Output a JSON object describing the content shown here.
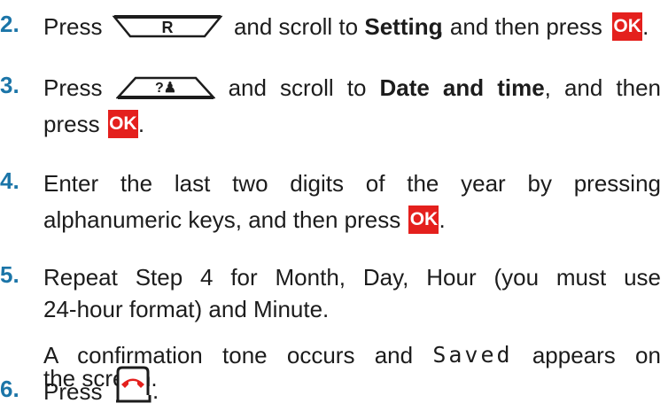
{
  "steps": [
    {
      "number": "2.",
      "lines": [
        {
          "t1": "Press",
          "key_label": "R",
          "t2": "and scroll to",
          "bold": "Setting",
          "t3": ", and then press",
          "ok": "OK",
          "end": "."
        }
      ]
    },
    {
      "number": "3.",
      "lines": [
        {
          "t1": "Press",
          "key_label": "?♟",
          "t2": "and scroll to",
          "bold": "Date and time",
          "t3": ", and then"
        },
        {
          "t1": "press",
          "ok": "OK",
          "end": "."
        }
      ]
    },
    {
      "number": "4.",
      "lines": [
        {
          "text": "Enter the last two digits of the year by pressing"
        },
        {
          "text": "alphanumeric keys, and then press",
          "ok": "OK",
          "end": "."
        }
      ]
    },
    {
      "number": "5.",
      "lines": [
        {
          "text": "Repeat Step 4 for Month, Day, Hour (you must use"
        },
        {
          "text": "24-hour format) and Minute."
        },
        {
          "t1": "A confirmation tone occurs and",
          "lcd": "Saved",
          "t2": "appears on"
        },
        {
          "text": "the screen."
        }
      ]
    },
    {
      "number": "6.",
      "lines": [
        {
          "t1": "Press",
          "end": "."
        }
      ]
    }
  ],
  "icons": {
    "r_key": "softkey-R-icon",
    "phonebook_key": "phonebook-key-icon",
    "ok_key": "ok-key-icon",
    "end_call_key": "end-call-key-icon"
  },
  "colors": {
    "step_number": "#1b75a8",
    "ok_key": "#e4201d",
    "end_call_handset": "#e4201d",
    "text": "#1c1c1c"
  }
}
